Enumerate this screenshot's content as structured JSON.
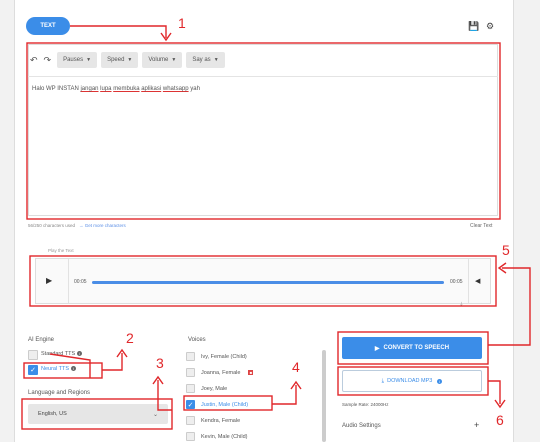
{
  "header": {
    "tab_label": "TEXT",
    "save_icon": "save-icon",
    "settings_icon": "gear-icon"
  },
  "toolbar": {
    "undo_icon": "undo-icon",
    "redo_icon": "redo-icon",
    "dropdowns": [
      "Pauses",
      "Speed",
      "Volume",
      "Say as"
    ]
  },
  "editor": {
    "text_plain_start": "Halo WP INSTAN ",
    "text_underlined": [
      "jangan",
      "lupa",
      "membuka",
      "aplikasi",
      "whatsapp"
    ],
    "text_plain_end": " yah",
    "char_count": "56/250 characters used",
    "get_more": "→ Get more characters",
    "clear_text": "Clear Text"
  },
  "player": {
    "label": "Play the Text",
    "current_time": "00:05",
    "end_time": "00:05",
    "progress": 1.0
  },
  "ai_engine": {
    "title": "AI Engine",
    "options": [
      {
        "label": "Standard TTS",
        "checked": false
      },
      {
        "label": "Neural TTS",
        "checked": true
      }
    ]
  },
  "language": {
    "title": "Language and Regions",
    "selected": "English, US"
  },
  "voices": {
    "title": "Voices",
    "items": [
      {
        "label": "Ivy, Female (Child)",
        "checked": false
      },
      {
        "label": "Joanna, Female",
        "checked": false,
        "badge": true
      },
      {
        "label": "Joey, Male",
        "checked": false
      },
      {
        "label": "Justin, Male (Child)",
        "checked": true
      },
      {
        "label": "Kendra, Female",
        "checked": false
      },
      {
        "label": "Kevin, Male (Child)",
        "checked": false
      }
    ]
  },
  "actions": {
    "convert_label": "CONVERT TO SPEECH",
    "download_label": "DOWNLOAD MP3",
    "sample_rate": "Sample Rate: 24000Hz",
    "audio_settings": "Audio Settings"
  },
  "annotations": {
    "labels": [
      "1",
      "2",
      "3",
      "4",
      "5",
      "6"
    ],
    "color": "#e0272a"
  },
  "colors": {
    "accent": "#3b8de8"
  }
}
